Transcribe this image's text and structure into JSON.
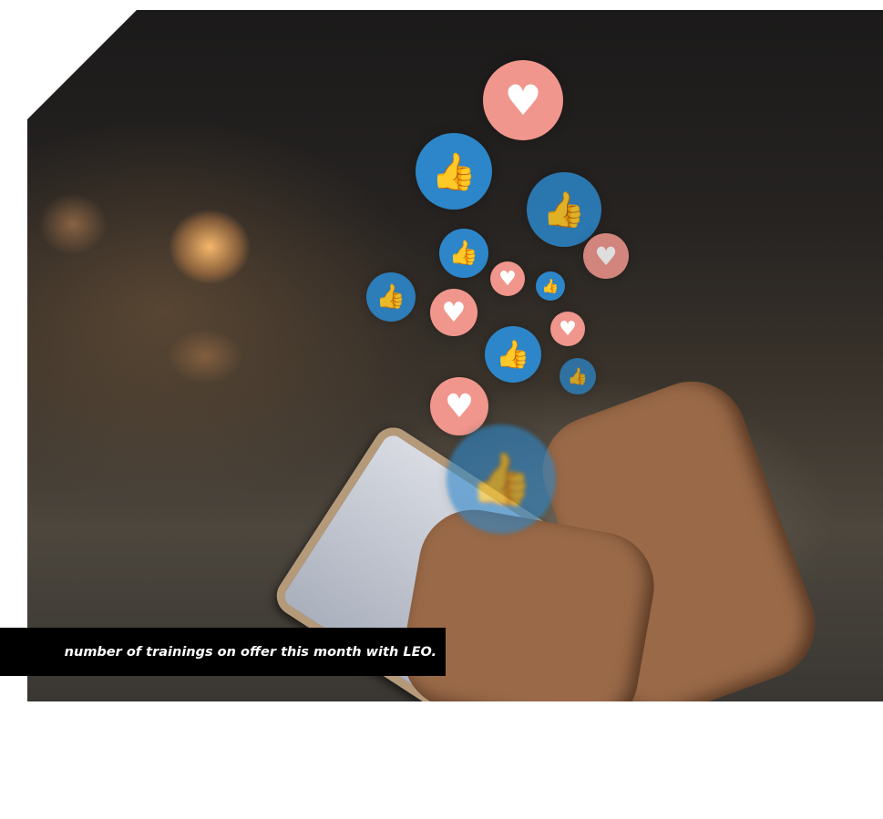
{
  "hero": {
    "icons": {
      "like": "thumbs-up-icon",
      "heart": "heart-icon"
    },
    "colors": {
      "like_bubble": "#2c86c9",
      "heart_bubble": "#f0968c",
      "caption_background": "#000000",
      "caption_text": "#ffffff"
    }
  },
  "caption": {
    "text": "number of trainings on offer this month with LEO."
  }
}
